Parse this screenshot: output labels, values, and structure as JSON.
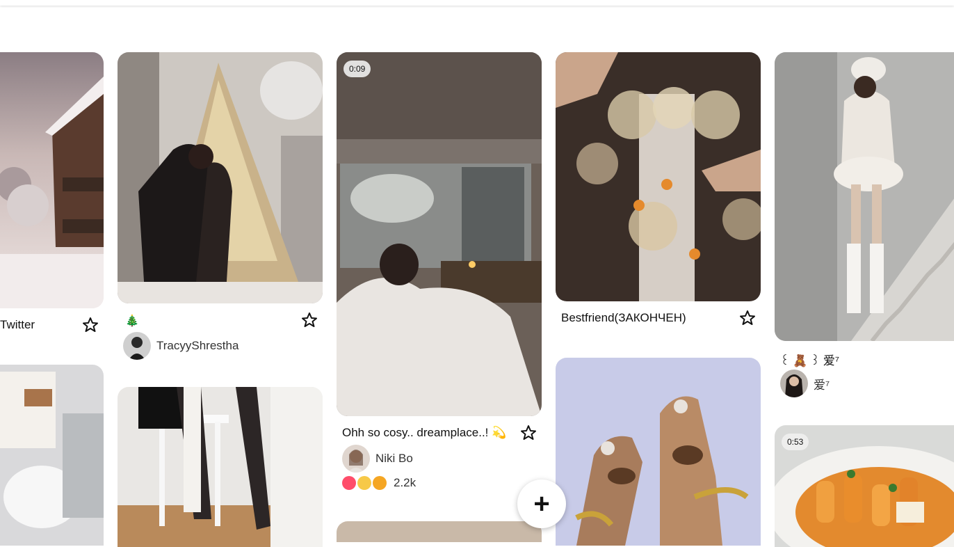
{
  "pins": [
    {
      "title": "Twitter"
    },
    {
      "title": "🎄",
      "author": "TracyyShrestha"
    },
    {
      "duration": "0:09",
      "title": "Ohh so cosy.. dreamplace..! 💫",
      "author": "Niki Bo",
      "reactions": "2.2k"
    },
    {
      "title": "Bestfriend(ЗАКОНЧЕН)"
    },
    {
      "title": "꒰ 🧸 ꒱ 爱⁷",
      "author": "爱⁷"
    },
    {
      "duration": "0:53"
    }
  ],
  "add_button_label": "+"
}
